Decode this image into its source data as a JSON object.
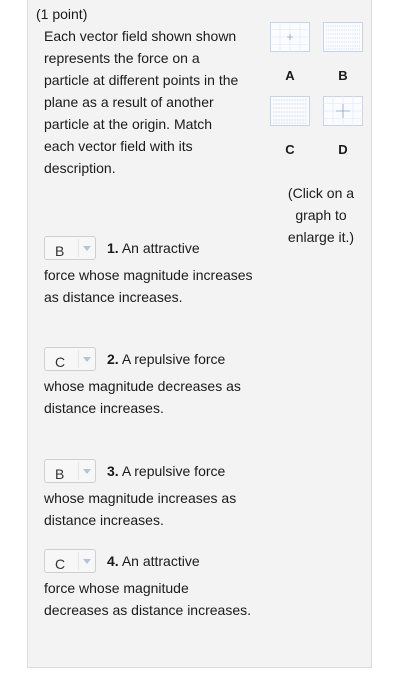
{
  "question": {
    "points_label": "(1 point)",
    "intro_text": "Each vector field shown shown represents the force on a particle at different points in the plane as a result of another particle at the origin. Match each vector field with its description.",
    "enlarge_hint": "(Click on a graph to enlarge it.)"
  },
  "graphs": [
    {
      "label": "A",
      "icon": "vector-field-thumbnail"
    },
    {
      "label": "B",
      "icon": "vector-field-thumbnail"
    },
    {
      "label": "C",
      "icon": "vector-field-thumbnail"
    },
    {
      "label": "D",
      "icon": "vector-field-thumbnail"
    }
  ],
  "items": [
    {
      "selected": "B",
      "number": "1.",
      "first_line": "An attractive",
      "rest": "force whose magnitude increases as distance increases."
    },
    {
      "selected": "C",
      "number": "2.",
      "first_line": "A repulsive force",
      "rest": "whose magnitude decreases as distance increases."
    },
    {
      "selected": "B",
      "number": "3.",
      "first_line": "A repulsive force",
      "rest": "whose magnitude increases as distance increases."
    },
    {
      "selected": "C",
      "number": "4.",
      "first_line": "An attractive",
      "rest": "force whose magnitude decreases as distance increases."
    }
  ],
  "colors": {
    "panel_bg": "#f3f3f3",
    "thumb_border": "#c9d3e6",
    "caret": "#b9c3d6"
  }
}
